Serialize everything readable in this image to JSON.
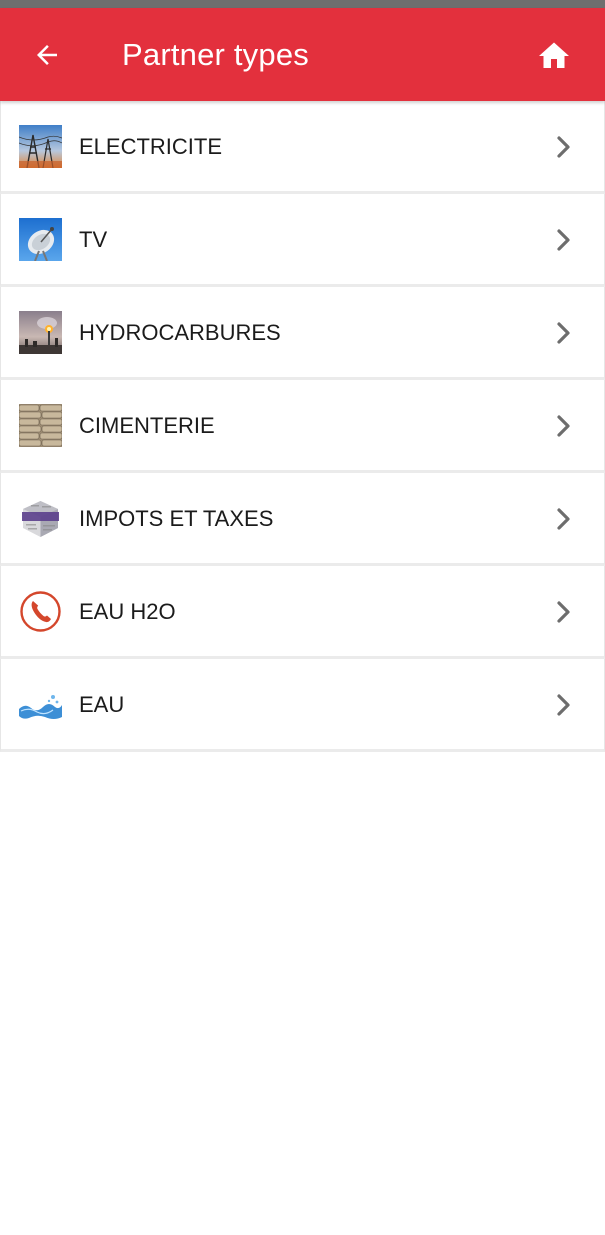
{
  "header": {
    "title": "Partner types",
    "back_icon": "arrow-left-icon",
    "home_icon": "home-icon",
    "background_color": "#e3303d"
  },
  "partner_types": [
    {
      "label": "ELECTRICITE",
      "icon": "power-lines-thumbnail"
    },
    {
      "label": "TV",
      "icon": "satellite-dish-thumbnail"
    },
    {
      "label": "HYDROCARBURES",
      "icon": "refinery-flare-thumbnail"
    },
    {
      "label": "CIMENTERIE",
      "icon": "cement-bags-thumbnail"
    },
    {
      "label": "IMPOTS ET TAXES",
      "icon": "impots-cube-thumbnail"
    },
    {
      "label": "EAU H2O",
      "icon": "phone-circle-thumbnail"
    },
    {
      "label": "EAU",
      "icon": "water-splash-thumbnail"
    }
  ],
  "row_chevron_icon": "chevron-right-icon"
}
